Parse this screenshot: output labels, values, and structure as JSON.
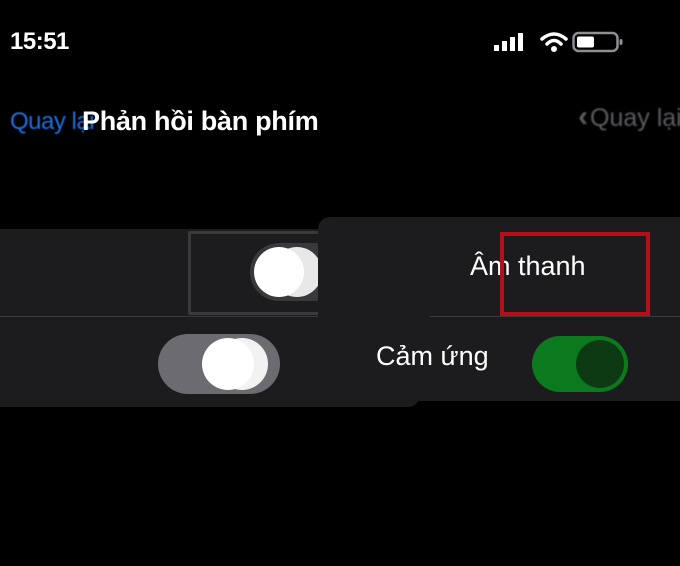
{
  "status_bar": {
    "time": "15:51",
    "signal_icon": "cellular-signal-icon",
    "wifi_icon": "wifi-icon",
    "battery_icon": "battery-icon"
  },
  "nav": {
    "back_left_label": "Quay lại",
    "title": "Phản hồi bàn phím",
    "back_right_label": "Quay lại",
    "back_icon": "chevron-left-icon"
  },
  "settings": {
    "rows": [
      {
        "label": "Âm thanh",
        "on": false
      },
      {
        "label": "Cảm ứng",
        "on": true
      }
    ]
  },
  "colors": {
    "background": "#000000",
    "group_background": "#1c1c1e",
    "toggle_on": "#0b7a1e",
    "link_blue": "#1e6fe0",
    "highlight_red": "#b5101a"
  }
}
